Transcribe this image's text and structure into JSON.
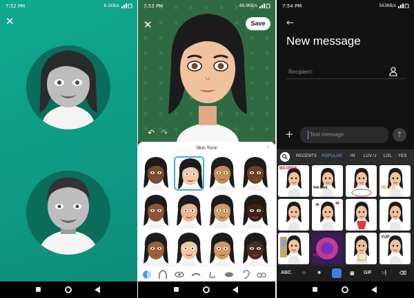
{
  "phones": [
    {
      "status": {
        "time": "7:52 PM",
        "icons": "▲",
        "net": "8.1KB/s"
      },
      "close_icon": "close-icon",
      "avatars": [
        "female-avatar",
        "male-avatar"
      ],
      "background": "#0e9a85"
    },
    {
      "status": {
        "time": "7:53 PM",
        "icons": "▲",
        "net": "49.9KB/s"
      },
      "save_label": "Save",
      "tone_title": "Skin Tone",
      "undo_icon": "undo-icon",
      "redo_icon": "redo-icon",
      "skin_tones": [
        [
          "#7a4a2e",
          "#f0c9a6",
          "#c48b55",
          "#6e3f24"
        ],
        [
          "#8c5533",
          "#e9b592",
          "#d29a66",
          "#3c2316"
        ],
        [
          "#9a603a",
          "#f1c7a2",
          "#cf9a60",
          "#4b2b1b"
        ]
      ],
      "selected_tone": "row-0-col-1",
      "categories": [
        "skin-tone-icon",
        "hair-icon",
        "eye-icon",
        "eyebrow-icon",
        "nose-icon",
        "lips-icon",
        "ear-icon",
        "glasses-icon"
      ]
    },
    {
      "status": {
        "time": "7:54 PM",
        "icons": "▲",
        "net": "563KB/s"
      },
      "title": "New message",
      "recipient_label": "Recipient:",
      "message_placeholder": "Text message",
      "keyboard_tabs": [
        "RECENTS",
        "POPULAR",
        "HI",
        "LUV U",
        "LOL",
        "YES"
      ],
      "active_tab": "POPULAR",
      "keyboard_bottom": [
        "ABC",
        "GIF",
        ":-)"
      ],
      "sticker_texts": [
        "BEARDS",
        "tee hee",
        "HELLO",
        "CONGRATS",
        "YUP"
      ],
      "accent": "#6ea8ff"
    }
  ]
}
